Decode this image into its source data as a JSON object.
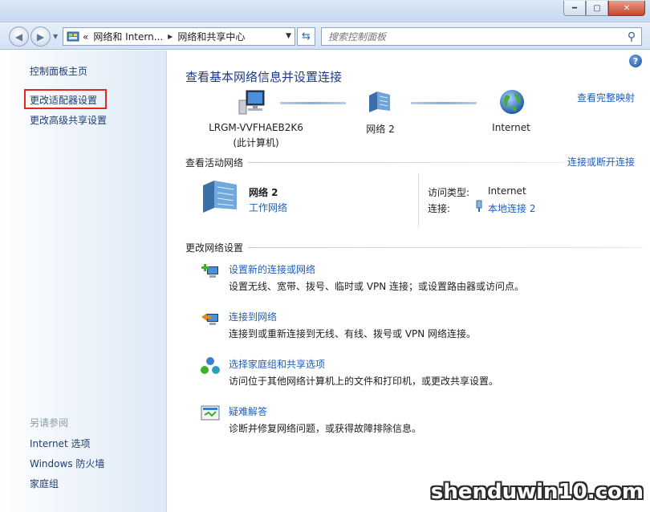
{
  "nav": {
    "breadcrumb_prefix": "«",
    "breadcrumb_1": "网络和 Intern...",
    "breadcrumb_2": "网络和共享中心",
    "search_placeholder": "搜索控制面板"
  },
  "sidebar": {
    "home": "控制面板主页",
    "adapter_settings": "更改适配器设置",
    "advanced_sharing": "更改高级共享设置",
    "see_also": "另请参阅",
    "links": [
      "Internet 选项",
      "Windows 防火墙",
      "家庭组"
    ]
  },
  "main": {
    "heading": "查看基本网络信息并设置连接",
    "full_map": "查看完整映射",
    "map": {
      "computer_name": "LRGM-VVFHAEB2K6",
      "computer_sub": "(此计算机)",
      "network": "网络  2",
      "internet": "Internet"
    },
    "active_section": {
      "title": "查看活动网络",
      "connect_disconnect": "连接或断开连接",
      "network_name": "网络  2",
      "network_type": "工作网络",
      "access_type_label": "访问类型:",
      "access_type_value": "Internet",
      "connection_label": "连接:",
      "connection_value": "本地连接 2"
    },
    "change_section": {
      "title": "更改网络设置",
      "tasks": [
        {
          "title": "设置新的连接或网络",
          "desc": "设置无线、宽带、拨号、临时或 VPN 连接；或设置路由器或访问点。"
        },
        {
          "title": "连接到网络",
          "desc": "连接到或重新连接到无线、有线、拨号或 VPN 网络连接。"
        },
        {
          "title": "选择家庭组和共享选项",
          "desc": "访问位于其他网络计算机上的文件和打印机，或更改共享设置。"
        },
        {
          "title": "疑难解答",
          "desc": "诊断并修复网络问题，或获得故障排除信息。"
        }
      ]
    }
  },
  "watermark": "shenduwin10.com",
  "colors": {
    "link": "#1f5fb4",
    "heading": "#1c3a8a",
    "highlight": "#e0281c"
  }
}
